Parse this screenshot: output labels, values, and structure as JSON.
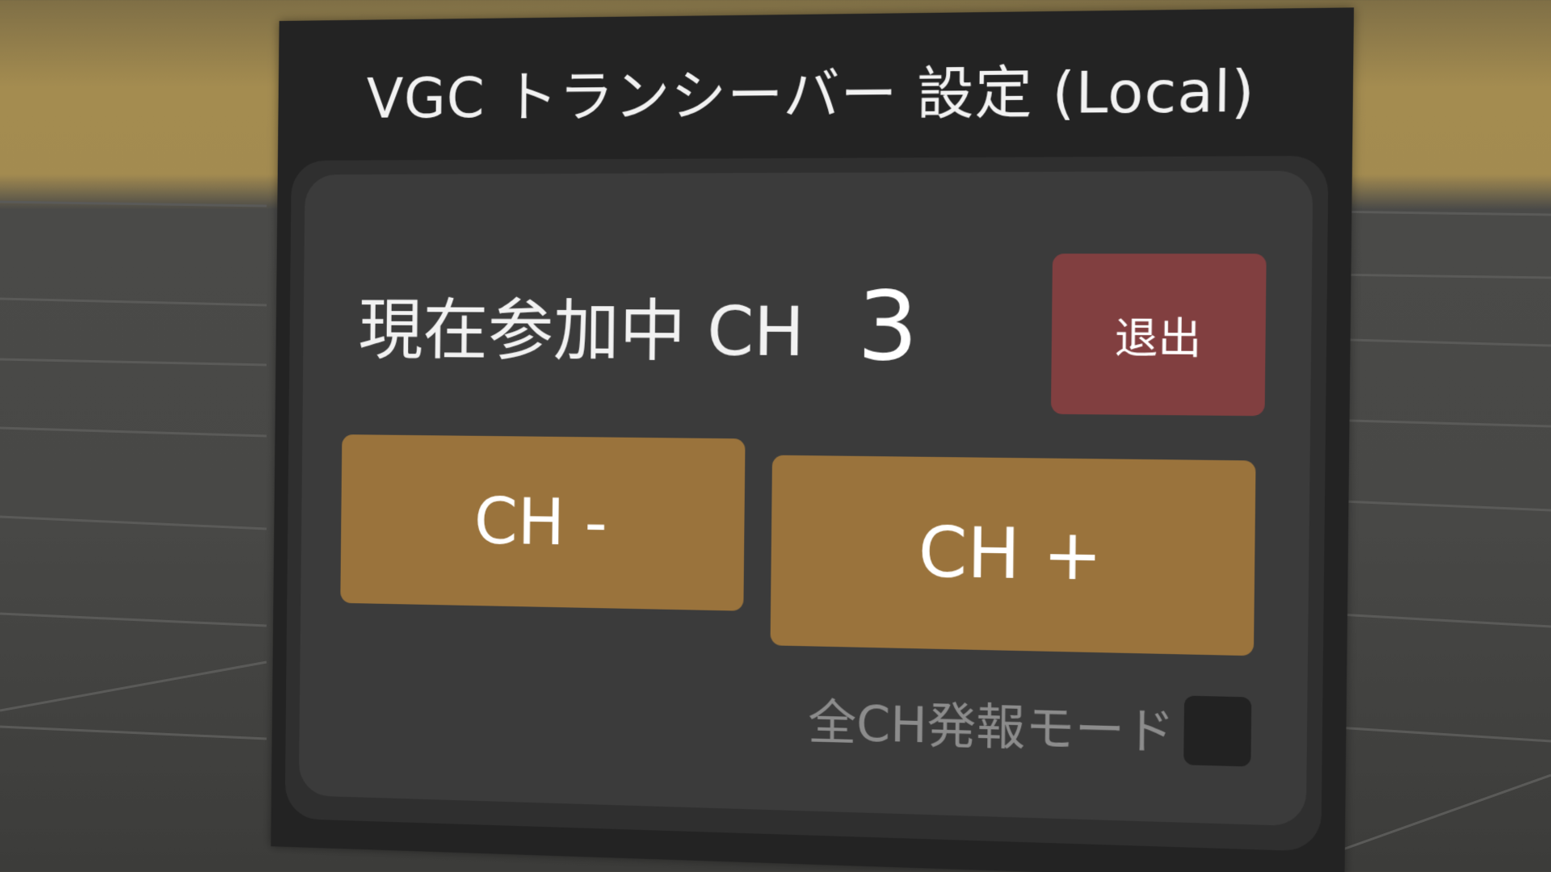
{
  "window": {
    "title": "VGC トランシーバー 設定 (Local)"
  },
  "channel": {
    "label": "現在参加中 CH",
    "value": "3",
    "leave_label": "退出",
    "minus_label": "CH -",
    "plus_label": "CH +"
  },
  "broadcast": {
    "label": "全CH発報モード",
    "checked": false
  },
  "colors": {
    "panel": "#232323",
    "inner": "#3b3b3b",
    "leave_button": "#813f40",
    "channel_button": "#9a733c",
    "sky": "#a38b50",
    "floor": "#484846"
  }
}
